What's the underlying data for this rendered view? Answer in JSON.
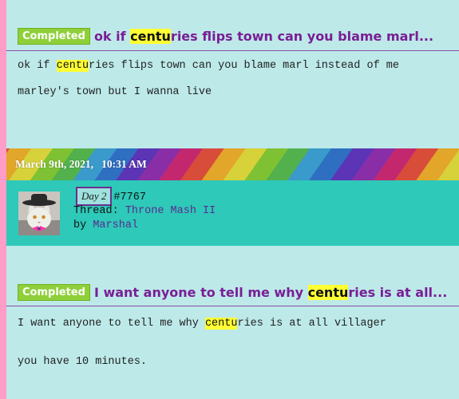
{
  "post1": {
    "badge": "Completed",
    "title_pre": "ok if ",
    "title_hl": "centu",
    "title_post": "ries flips town can you blame marl...",
    "body_line1_pre": "ok if ",
    "body_line1_hl": "centu",
    "body_line1_post": "ries flips town can you blame marl instead of me",
    "body_line2": "marley's town but I wanna live"
  },
  "thread_header": {
    "date": "March 9th, 2021,   10:31 AM",
    "day_badge": "Day 2",
    "post_number": "#7767",
    "thread_label": "Thread: ",
    "thread_name": "Throne Mash II",
    "by_label": "by ",
    "author": "Marshal",
    "avatar_icon": "cat-cowboy-avatar-icon"
  },
  "post2": {
    "badge": "Completed",
    "title_pre": "I want anyone to tell me why ",
    "title_hl": "centu",
    "title_post": "ries is at all...",
    "body_line1_pre": "I want anyone to tell me why ",
    "body_line1_hl": "centu",
    "body_line1_post": "ries is at all villager",
    "body_line2": "you have 10 minutes."
  },
  "colors": {
    "panel": "#bde9e9",
    "accent_purple": "#7a1e96",
    "highlight": "#ffff33",
    "badge_green": "#8fcf3a",
    "info_teal": "#2ec9b9",
    "page_pink": "#ff9cc8"
  }
}
